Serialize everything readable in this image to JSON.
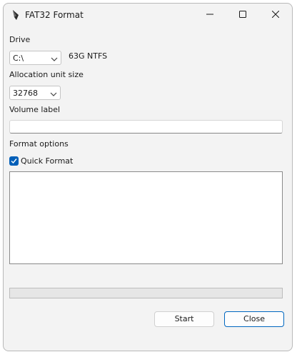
{
  "window": {
    "title": "FAT32 Format"
  },
  "titlebar": {
    "app_icon": "pen-nib-icon",
    "minimize_icon": "minimize-icon",
    "maximize_icon": "maximize-icon",
    "close_icon": "close-icon"
  },
  "drive": {
    "label": "Drive",
    "selected": "C:\\",
    "info": "63G NTFS"
  },
  "allocation": {
    "label": "Allocation unit size",
    "selected": "32768"
  },
  "volume": {
    "label": "Volume label",
    "value": ""
  },
  "options": {
    "label": "Format options",
    "quick_format_label": "Quick Format",
    "quick_format_checked": true
  },
  "progress": {
    "value": 0
  },
  "buttons": {
    "start_label": "Start",
    "close_label": "Close"
  },
  "colors": {
    "accent": "#005fb8",
    "window_bg": "#f3f3f3"
  }
}
